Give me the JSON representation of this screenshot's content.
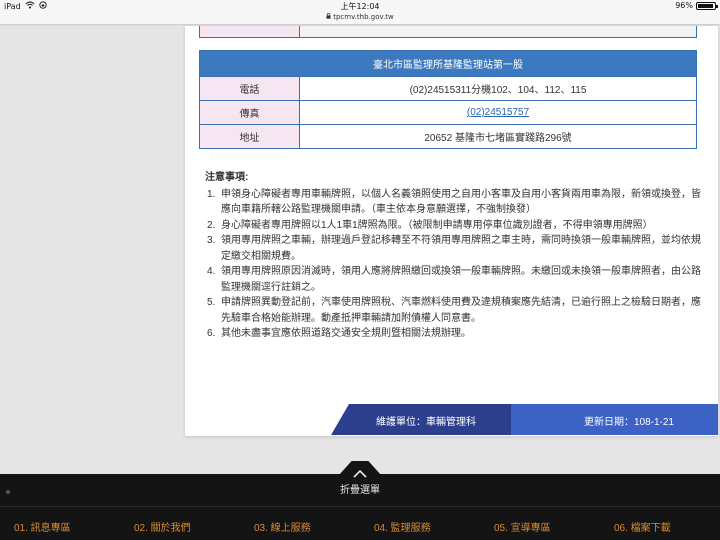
{
  "status_bar": {
    "device": "iPad",
    "time": "上午12:04",
    "battery": "96%"
  },
  "url_bar": {
    "url": "tpcmv.thb.gov.tw"
  },
  "station_table": {
    "title": "臺北市區監理所基隆監理站第一股",
    "rows": [
      {
        "label": "電話",
        "value": "(02)24515311分機102、104、112、115"
      },
      {
        "label": "傳真",
        "value": "(02)24515757"
      },
      {
        "label": "地址",
        "value": "20652 基隆市七堵區實踐路296號"
      }
    ]
  },
  "notes": {
    "heading": "注意事項:",
    "items": [
      {
        "num": "1.",
        "text": "申領身心障礙者專用車輛牌照，以個人名義領照使用之自用小客車及自用小客貨兩用車為限，新領或換登，皆應向車籍所轄公路監理機關申請。（車主依本身意願選擇，不強制換發）"
      },
      {
        "num": "2.",
        "text": "身心障礙者專用牌照以1人1車1牌照為限。（被限制申請專用停車位識別證者，不得申領專用牌照）"
      },
      {
        "num": "3.",
        "text": "領用專用牌照之車輛，辦理過戶登記移轉至不符領用專用牌照之車主時，需同時換領一般車輛牌照，並均依規定繳交相關規費。"
      },
      {
        "num": "4.",
        "text": "領用專用牌照原因消滅時，領用人應將牌照繳回或換領一般車輛牌照。未繳回或未換領一般車牌照者，由公路監理機關逕行註銷之。"
      },
      {
        "num": "5.",
        "text": "申請牌照異動登記前，汽車使用牌照稅、汽車燃料使用費及違規積案應先結清，已逾行照上之檢驗日期者，應先驗車合格始能辦理。動產抵押車輛請加附債權人同意書。"
      },
      {
        "num": "6.",
        "text": "其他未盡事宜應依照道路交通安全規則暨相關法規辦理。"
      }
    ]
  },
  "footer": {
    "maintainer": "維護單位：車輛管理科",
    "updated": "更新日期：108-1-21"
  },
  "menu": {
    "collapse_label": "折疊選單",
    "items": [
      "01. 訊息專區",
      "02. 關於我們",
      "03. 線上服務",
      "04. 監理服務",
      "05. 宣導專區",
      "06. 檔案下載"
    ]
  },
  "colors": {
    "header_blue": "#3d79bf",
    "label_pink": "#f6e6f1",
    "menu_orange": "#d98a2e",
    "menu_bg": "#141414"
  }
}
